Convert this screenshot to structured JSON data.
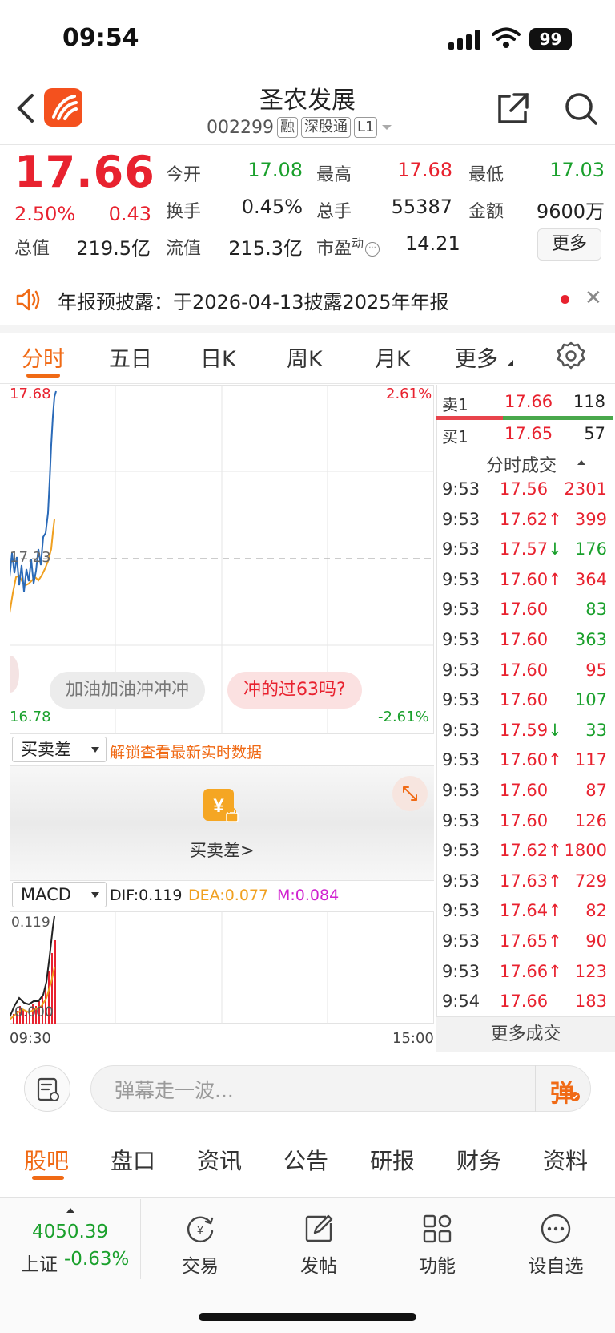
{
  "status_bar": {
    "time": "09:54",
    "battery": "99"
  },
  "header": {
    "title": "圣农发展",
    "code": "002299",
    "tags": [
      "融",
      "深股通",
      "L1"
    ]
  },
  "quote": {
    "price": "17.66",
    "change_pct": "2.50%",
    "change": "0.43",
    "fields": [
      {
        "label": "今开",
        "value": "17.08",
        "color": "green"
      },
      {
        "label": "最高",
        "value": "17.68",
        "color": "red"
      },
      {
        "label": "最低",
        "value": "17.03",
        "color": "green"
      },
      {
        "label": "换手",
        "value": "0.45%",
        "color": "black"
      },
      {
        "label": "总手",
        "value": "55387",
        "color": "black"
      },
      {
        "label": "金额",
        "value": "9600万",
        "color": "black"
      },
      {
        "label": "总值",
        "value": "219.5亿",
        "color": "black"
      },
      {
        "label": "流值",
        "value": "215.3亿",
        "color": "black"
      },
      {
        "label": "市盈",
        "sup": "动",
        "value": "14.21",
        "color": "black"
      }
    ],
    "more_label": "更多"
  },
  "notice": {
    "text": "年报预披露：于2026-04-13披露2025年年报"
  },
  "period_tabs": [
    "分时",
    "五日",
    "日K",
    "周K",
    "月K",
    "更多"
  ],
  "chart": {
    "price_top": "17.68",
    "price_mid": "17.23",
    "price_bottom": "16.78",
    "pct_top": "2.61%",
    "pct_bottom": "-2.61%",
    "time_start": "09:30",
    "time_end": "15:00",
    "danmu": [
      "加油加油冲冲冲",
      "冲的过63吗?"
    ]
  },
  "order_book": {
    "sell_label": "卖1",
    "sell_price": "17.66",
    "sell_vol": "118",
    "buy_label": "买1",
    "buy_price": "17.65",
    "buy_vol": "57",
    "section_title": "分时成交",
    "trades": [
      {
        "time": "9:53",
        "price": "17.56",
        "arrow": "",
        "vol": "2301",
        "vol_color": "red"
      },
      {
        "time": "9:53",
        "price": "17.62",
        "arrow": "↑",
        "vol": "399",
        "vol_color": "red"
      },
      {
        "time": "9:53",
        "price": "17.57",
        "arrow": "↓",
        "vol": "176",
        "vol_color": "green"
      },
      {
        "time": "9:53",
        "price": "17.60",
        "arrow": "↑",
        "vol": "364",
        "vol_color": "red"
      },
      {
        "time": "9:53",
        "price": "17.60",
        "arrow": "",
        "vol": "83",
        "vol_color": "green"
      },
      {
        "time": "9:53",
        "price": "17.60",
        "arrow": "",
        "vol": "363",
        "vol_color": "green"
      },
      {
        "time": "9:53",
        "price": "17.60",
        "arrow": "",
        "vol": "95",
        "vol_color": "red"
      },
      {
        "time": "9:53",
        "price": "17.60",
        "arrow": "",
        "vol": "107",
        "vol_color": "green"
      },
      {
        "time": "9:53",
        "price": "17.59",
        "arrow": "↓",
        "vol": "33",
        "vol_color": "green"
      },
      {
        "time": "9:53",
        "price": "17.60",
        "arrow": "↑",
        "vol": "117",
        "vol_color": "red"
      },
      {
        "time": "9:53",
        "price": "17.60",
        "arrow": "",
        "vol": "87",
        "vol_color": "red"
      },
      {
        "time": "9:53",
        "price": "17.60",
        "arrow": "",
        "vol": "126",
        "vol_color": "red"
      },
      {
        "time": "9:53",
        "price": "17.62",
        "arrow": "↑",
        "vol": "1800",
        "vol_color": "red"
      },
      {
        "time": "9:53",
        "price": "17.63",
        "arrow": "↑",
        "vol": "729",
        "vol_color": "red"
      },
      {
        "time": "9:53",
        "price": "17.64",
        "arrow": "↑",
        "vol": "82",
        "vol_color": "red"
      },
      {
        "time": "9:53",
        "price": "17.65",
        "arrow": "↑",
        "vol": "90",
        "vol_color": "red"
      },
      {
        "time": "9:53",
        "price": "17.66",
        "arrow": "↑",
        "vol": "123",
        "vol_color": "red"
      },
      {
        "time": "9:54",
        "price": "17.66",
        "arrow": "",
        "vol": "183",
        "vol_color": "red"
      }
    ],
    "more_trades": "更多成交"
  },
  "spread": {
    "select": "买卖差",
    "unlock": "解锁查看最新实时数据",
    "button": "买卖差>"
  },
  "macd": {
    "select": "MACD",
    "dif": "DIF:0.119",
    "dea": "DEA:0.077",
    "m": "M:0.084",
    "top": "0.119",
    "bottom": "0.000"
  },
  "comment": {
    "placeholder": "弹幕走一波...",
    "danmu_btn": "弹"
  },
  "bottom_tabs": [
    "股吧",
    "盘口",
    "资讯",
    "公告",
    "研报",
    "财务",
    "资料"
  ],
  "index": {
    "value": "4050.39",
    "name": "上证",
    "pct": "-0.63%"
  },
  "nav": [
    "交易",
    "发帖",
    "功能",
    "设自选"
  ],
  "colors": {
    "up": "#e8222f",
    "down": "#1aa02c",
    "accent": "#f06a15",
    "line_price": "#2a6ab8",
    "line_avg": "#f0a020"
  }
}
